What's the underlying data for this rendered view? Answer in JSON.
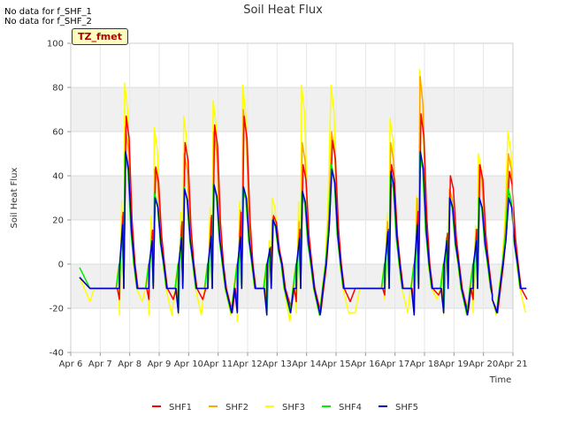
{
  "notes": [
    "No data for f_SHF_1",
    "No data for f_SHF_2"
  ],
  "badge": "TZ_fmet",
  "chart_data": {
    "type": "line",
    "title": "Soil Heat Flux",
    "xlabel": "Time",
    "ylabel": "Soil Heat Flux",
    "x_ticks": [
      "Apr 6",
      "Apr 7",
      "Apr 8",
      "Apr 9",
      "Apr 10",
      "Apr 11",
      "Apr 12",
      "Apr 13",
      "Apr 14",
      "Apr 15",
      "Apr 16",
      "Apr 17",
      "Apr 18",
      "Apr 19",
      "Apr 20",
      "Apr 21"
    ],
    "xlim": [
      6,
      21
    ],
    "ylim": [
      -40,
      100
    ],
    "y_ticks": [
      -40,
      -20,
      0,
      20,
      40,
      60,
      80,
      100
    ],
    "grid": true,
    "legend_position": "bottom",
    "series": [
      {
        "name": "SHF1",
        "color": "#ff0000"
      },
      {
        "name": "SHF2",
        "color": "#ffa500"
      },
      {
        "name": "SHF3",
        "color": "#ffff00"
      },
      {
        "name": "SHF4",
        "color": "#00ee00"
      },
      {
        "name": "SHF5",
        "color": "#0000cc"
      }
    ],
    "daily_peaks": {
      "days": [
        7,
        8,
        9,
        10,
        11,
        12,
        13,
        14,
        16,
        17,
        18,
        19,
        20
      ],
      "SHF1": [
        67,
        44,
        55,
        63,
        67,
        22,
        45,
        56,
        45,
        68,
        40,
        45,
        42
      ],
      "SHF2": [
        62,
        43,
        50,
        60,
        70,
        21,
        55,
        60,
        55,
        85,
        34,
        45,
        50
      ],
      "SHF3": [
        82,
        62,
        67,
        74,
        81,
        30,
        81,
        81,
        66,
        88,
        34,
        50,
        60
      ],
      "SHF4": [
        50,
        32,
        35,
        36,
        34,
        20,
        32,
        45,
        40,
        50,
        30,
        30,
        34
      ],
      "SHF5": [
        51,
        30,
        34,
        36,
        35,
        20,
        33,
        43,
        42,
        51,
        30,
        30,
        30
      ]
    },
    "daily_minimum": {
      "days": [
        7,
        8,
        9,
        10,
        11,
        12,
        13,
        14,
        16,
        17,
        18,
        19,
        20
      ],
      "SHF1": [
        -11,
        -16,
        -16,
        -22,
        -11,
        -20,
        -22,
        -17,
        -11,
        -14,
        -22,
        -22,
        -16
      ],
      "SHF3": [
        -17,
        -23,
        -23,
        -23,
        -11,
        -26,
        -23,
        -22,
        -22,
        -16,
        -23,
        -23,
        -22
      ],
      "SHF5": [
        -11,
        -11,
        -11,
        -22,
        -11,
        -22,
        -23,
        -11,
        -11,
        -11,
        -23,
        -22,
        -11
      ]
    }
  }
}
